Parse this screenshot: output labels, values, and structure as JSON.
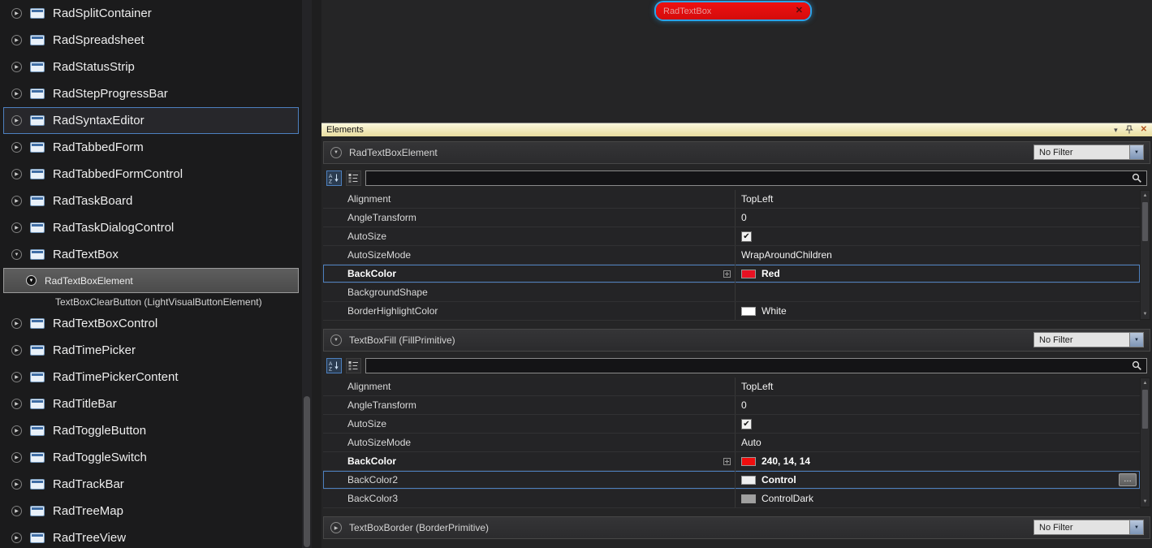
{
  "panel": {
    "title": "Elements"
  },
  "preview": {
    "textbox_text": "RadTextBox",
    "fill_color": "#ee1010",
    "outline_color": "#2ba3e8",
    "text_color": "#e89a9a"
  },
  "colors": {
    "selection_blue": "#4d80bf",
    "panel_header_yellow": "#f3e9b5",
    "sidebar_background": "#1b1b1c",
    "grid_background": "#242426"
  },
  "icons": {
    "clear": "✕",
    "panel_menu": "▾",
    "panel_pin": "pin",
    "panel_close": "✕",
    "dropdown": "▼",
    "check": "✔",
    "up": "▲",
    "down": "▼",
    "tree_collapsed": "▶",
    "tree_expanded": "▼",
    "section_expanded": "▼",
    "section_collapsed": "▶",
    "element_marker": "▼",
    "ellipsis": "…",
    "search": "magnifier",
    "sort_alphabetical": "A-Z-down",
    "categorized": "category-list"
  },
  "sidebar": {
    "items": [
      {
        "label": "RadSplitContainer"
      },
      {
        "label": "RadSpreadsheet"
      },
      {
        "label": "RadStatusStrip"
      },
      {
        "label": "RadStepProgressBar"
      },
      {
        "label": "RadSyntaxEditor",
        "selected": true
      },
      {
        "label": "RadTabbedForm"
      },
      {
        "label": "RadTabbedFormControl"
      },
      {
        "label": "RadTaskBoard"
      },
      {
        "label": "RadTaskDialogControl"
      },
      {
        "label": "RadTextBox",
        "expanded": true
      },
      {
        "label": "RadTextBoxElement",
        "level": 1,
        "element_selected": true
      },
      {
        "label": "TextBoxClearButton (LightVisualButtonElement)",
        "level": 2,
        "plain": true
      },
      {
        "label": "RadTextBoxControl"
      },
      {
        "label": "RadTimePicker"
      },
      {
        "label": "RadTimePickerContent"
      },
      {
        "label": "RadTitleBar"
      },
      {
        "label": "RadToggleButton"
      },
      {
        "label": "RadToggleSwitch"
      },
      {
        "label": "RadTrackBar"
      },
      {
        "label": "RadTreeMap"
      },
      {
        "label": "RadTreeView"
      }
    ]
  },
  "sections": [
    {
      "title": "RadTextBoxElement",
      "filter_label": "No Filter",
      "expanded": true,
      "search_value": "",
      "rows": [
        {
          "name": "Alignment",
          "value": "TopLeft"
        },
        {
          "name": "AngleTransform",
          "value": "0"
        },
        {
          "name": "AutoSize",
          "checkbox": true
        },
        {
          "name": "AutoSizeMode",
          "value": "WrapAroundChildren"
        },
        {
          "name": "BackColor",
          "value": "Red",
          "swatch": "#e81123",
          "name_bold": true,
          "value_bold": true,
          "selected": true,
          "expandable": true
        },
        {
          "name": "BackgroundShape",
          "value": ""
        },
        {
          "name": "BorderHighlightColor",
          "value": "White",
          "swatch": "#ffffff"
        }
      ]
    },
    {
      "title": "TextBoxFill (FillPrimitive)",
      "filter_label": "No Filter",
      "expanded": true,
      "search_value": "",
      "rows": [
        {
          "name": "Alignment",
          "value": "TopLeft"
        },
        {
          "name": "AngleTransform",
          "value": "0"
        },
        {
          "name": "AutoSize",
          "checkbox": true
        },
        {
          "name": "AutoSizeMode",
          "value": "Auto"
        },
        {
          "name": "BackColor",
          "value": "240, 14, 14",
          "swatch": "#f00e0e",
          "name_bold": true,
          "value_bold": true,
          "expandable": true
        },
        {
          "name": "BackColor2",
          "value": "Control",
          "swatch": "#f0f0f0",
          "value_bold": true,
          "selected": true,
          "ellipsis": true
        },
        {
          "name": "BackColor3",
          "value": "ControlDark",
          "swatch": "#a0a0a0"
        }
      ]
    },
    {
      "title": "TextBoxBorder (BorderPrimitive)",
      "filter_label": "No Filter",
      "expanded": false,
      "rows": []
    }
  ]
}
